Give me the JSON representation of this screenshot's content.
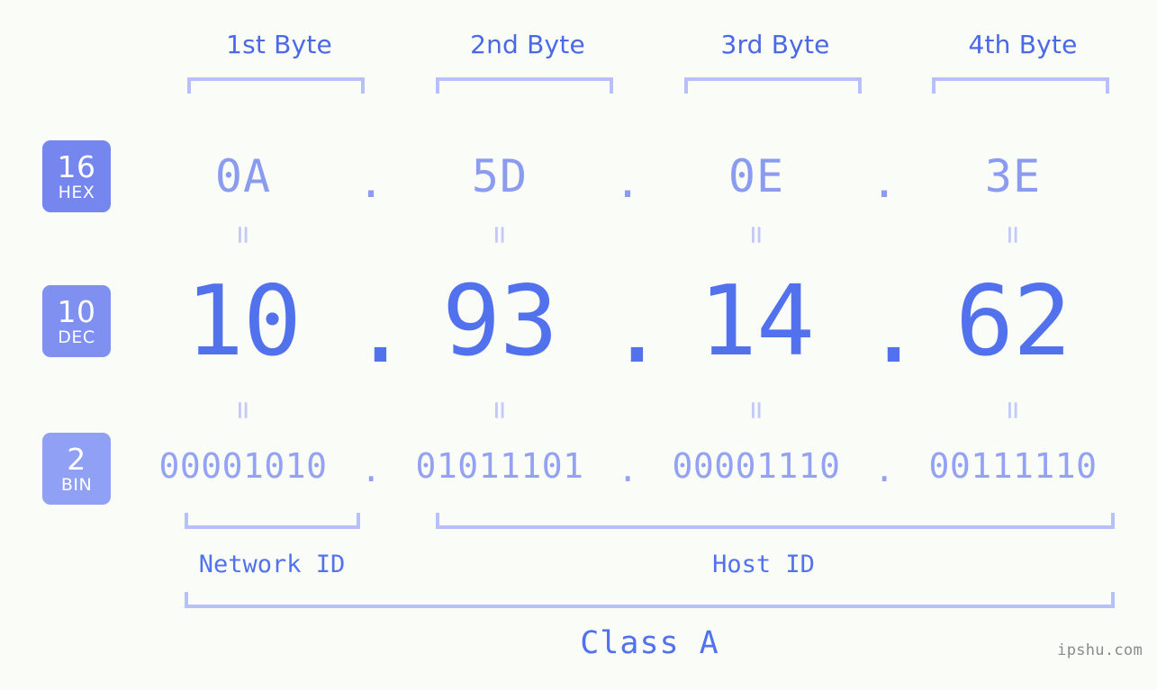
{
  "meta": {
    "watermark": "ipshu.com"
  },
  "headers": [
    {
      "label": "1st Byte"
    },
    {
      "label": "2nd Byte"
    },
    {
      "label": "3rd Byte"
    },
    {
      "label": "4th Byte"
    }
  ],
  "separator": ".",
  "equals_glyph": "=",
  "rows": [
    {
      "base_number": "16",
      "base_name": "HEX",
      "badge_color": "#7587ef",
      "values": [
        "0A",
        "5D",
        "0E",
        "3E"
      ]
    },
    {
      "base_number": "10",
      "base_name": "DEC",
      "badge_color": "#7f90f1",
      "values": [
        "10",
        "93",
        "14",
        "62"
      ]
    },
    {
      "base_number": "2",
      "base_name": "BIN",
      "badge_color": "#8fa0f5",
      "values": [
        "00001010",
        "01011101",
        "00001110",
        "00111110"
      ]
    }
  ],
  "sections": {
    "network_id": "Network ID",
    "host_id": "Host ID",
    "class": "Class A"
  },
  "colors": {
    "background": "#fafcf8",
    "accent_strong": "#5271ed",
    "accent_mid": "#8b9bf0",
    "accent_light": "#b7c0f9",
    "badge_text": "#ffffff"
  }
}
